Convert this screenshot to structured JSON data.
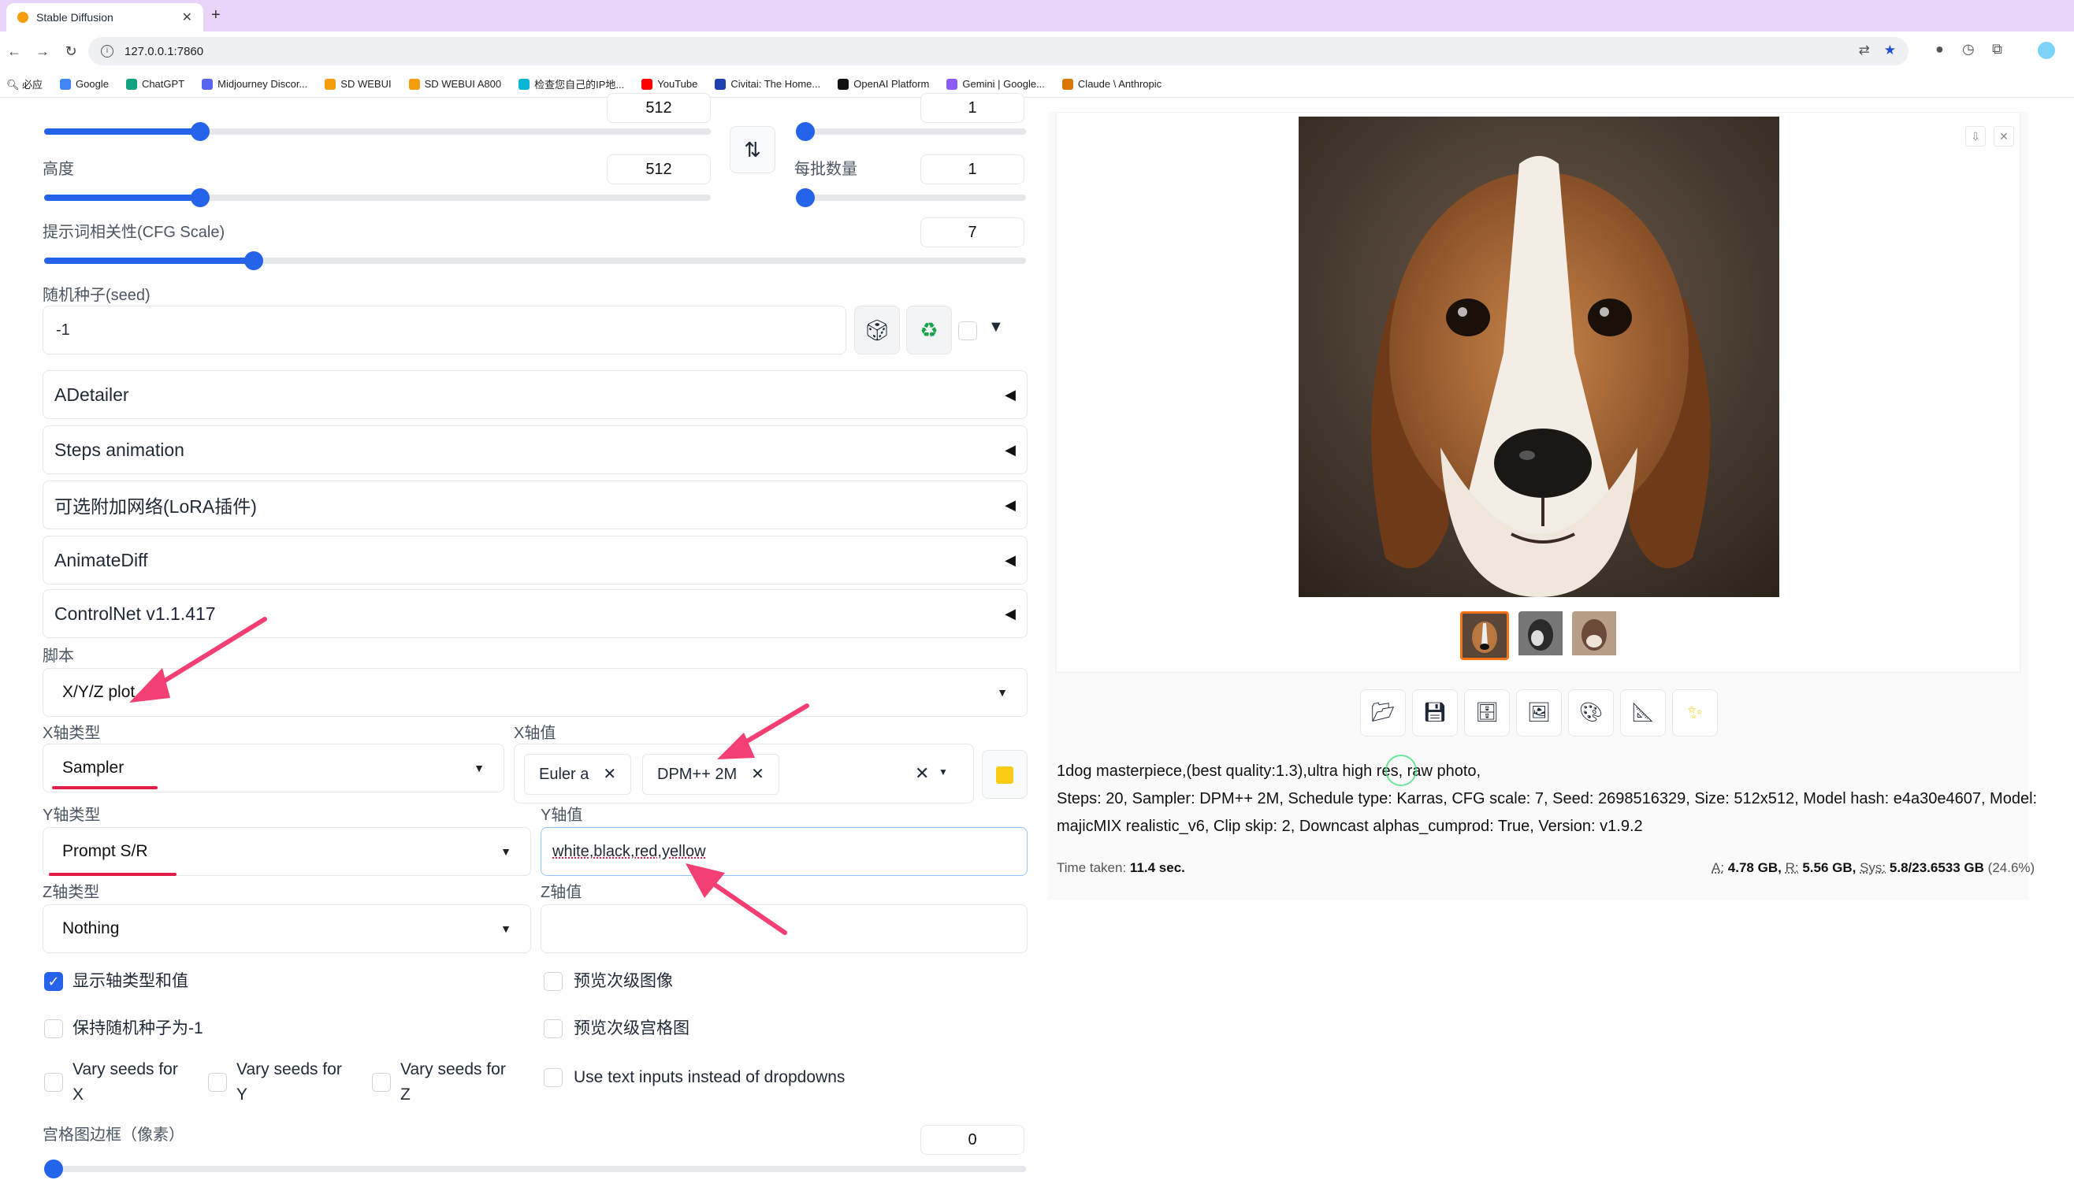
{
  "browser": {
    "tab_title": "Stable Diffusion",
    "url": "127.0.0.1:7860",
    "bookmarks": [
      "必应",
      "Google",
      "ChatGPT",
      "Midjourney Discor...",
      "SD WEBUI",
      "SD WEBUI A800",
      "检查您自己的IP地...",
      "YouTube",
      "Civitai: The Home...",
      "OpenAI Platform",
      "Gemini | Google...",
      "Claude \\ Anthropic"
    ]
  },
  "left": {
    "width_value": "512",
    "batch_count_value": "1",
    "height_label": "高度",
    "height_value": "512",
    "batch_size_label": "每批数量",
    "batch_size_value": "1",
    "cfg_label": "提示词相关性(CFG Scale)",
    "cfg_value": "7",
    "seed_label": "随机种子(seed)",
    "seed_value": "-1",
    "accordions": [
      "ADetailer",
      "Steps animation",
      "可选附加网络(LoRA插件)",
      "AnimateDiff",
      "ControlNet v1.1.417"
    ],
    "script_label": "脚本",
    "script_value": "X/Y/Z plot",
    "x_type_label": "X轴类型",
    "x_type_value": "Sampler",
    "x_values_label": "X轴值",
    "x_values": [
      "Euler a",
      "DPM++ 2M"
    ],
    "y_type_label": "Y轴类型",
    "y_type_value": "Prompt S/R",
    "y_values_label": "Y轴值",
    "y_values_value": "white,black,red,yellow",
    "z_type_label": "Z轴类型",
    "z_type_value": "Nothing",
    "z_values_label": "Z轴值",
    "checkboxes": {
      "show_axes": "显示轴类型和值",
      "keep_seed": "保持随机种子为-1",
      "preview_sub": "预览次级图像",
      "preview_grid": "预览次级宫格图",
      "vary_x": "Vary seeds for X",
      "vary_y": "Vary seeds for Y",
      "vary_z": "Vary seeds for Z",
      "text_inputs": "Use text inputs instead of dropdowns"
    },
    "grid_margin_label": "宫格图边框（像素）",
    "grid_margin_value": "0"
  },
  "right": {
    "prompt": "1dog masterpiece,(best quality:1.3),ultra high res, raw photo,",
    "params_line1": "Steps: 20, Sampler: DPM++ 2M, Schedule type: Karras, CFG scale: 7, Seed: 2698516329, Size: 512x512, Model hash: e4a30e4607, Model:",
    "params_line2": "majicMIX realistic_v6, Clip skip: 2, Downcast alphas_cumprod: True, Version: v1.9.2",
    "time_label": "Time taken:",
    "time_value": "11.4 sec.",
    "mem_a_label": "A:",
    "mem_a": "4.78 GB,",
    "mem_r_label": "R:",
    "mem_r": "5.56 GB,",
    "mem_sys_label": "Sys:",
    "mem_sys": "5.8/23.6533 GB",
    "mem_pct": "(24.6%)"
  },
  "colors": {
    "accent": "#2563eb",
    "annotation": "#f43f74",
    "tabstrip": "#e8d4f8"
  }
}
